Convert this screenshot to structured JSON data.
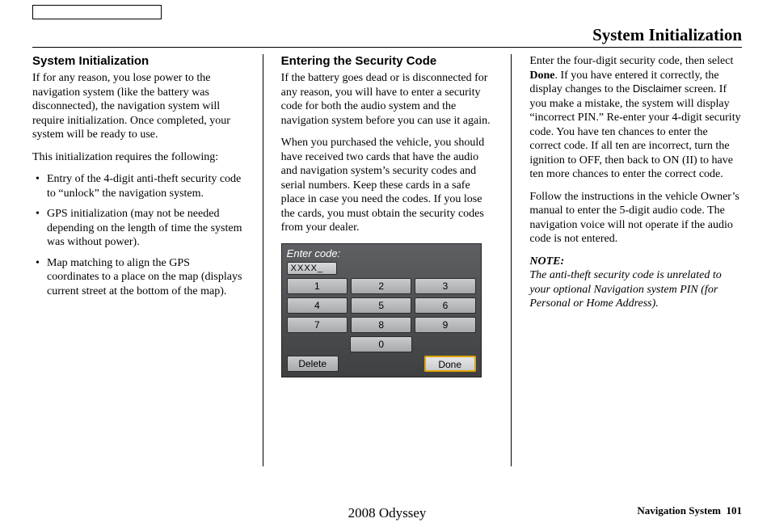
{
  "page_title": "System Initialization",
  "col1": {
    "heading": "System Initialization",
    "p1": "If for any reason, you lose power to the navigation system (like the battery was disconnected), the navigation system will require initialization. Once completed, your system will be ready to use.",
    "p2": "This initialization requires the following:",
    "bullets": [
      "Entry of the 4-digit anti-theft security code to “unlock” the navigation system.",
      "GPS initialization (may not be needed depending on the length of time the system was without power).",
      "Map matching to align the GPS coordinates to a place on the map (displays current street at the bottom of the map)."
    ]
  },
  "col2": {
    "heading": "Entering the Security Code",
    "p1": "If the battery goes dead or is disconnected for any reason, you will have to enter a security code for both the audio system and the navigation system before you can use it again.",
    "p2": "When you purchased the vehicle, you should have received two cards that have the audio and navigation system’s security codes and serial numbers. Keep these cards in a safe place in case you need the codes. If you lose the cards, you must obtain the security codes from your dealer.",
    "keypad": {
      "prompt": "Enter code:",
      "display": "XXXX_",
      "row1": [
        "1",
        "2",
        "3"
      ],
      "row2": [
        "4",
        "5",
        "6"
      ],
      "row3": [
        "7",
        "8",
        "9"
      ],
      "zero": "0",
      "delete": "Delete",
      "done": "Done"
    }
  },
  "col3": {
    "p1a": "Enter the four-digit security code, then select ",
    "p1b_bold": "Done",
    "p1c": ". If you have entered it correctly, the display changes to the ",
    "p1d_sans": "Disclaimer",
    "p1e": " screen. If you make a mistake, the system will display “incorrect PIN.” Re-enter your 4-digit security code. You have ten chances to enter the correct code. If all ten are incorrect, turn the ignition to OFF, then back to ON (II) to have ten more chances to enter the correct code.",
    "p2": "Follow the instructions in the vehicle Owner’s manual to enter the 5-digit audio code. The navigation voice will not operate if the audio code is not entered.",
    "note_head": "NOTE:",
    "note_body": "The anti-theft security code is unrelated to your optional Navigation system PIN (for Personal or Home Address)."
  },
  "footer": {
    "center": "2008  Odyssey",
    "right_label": "Navigation System",
    "page_no": "101"
  }
}
